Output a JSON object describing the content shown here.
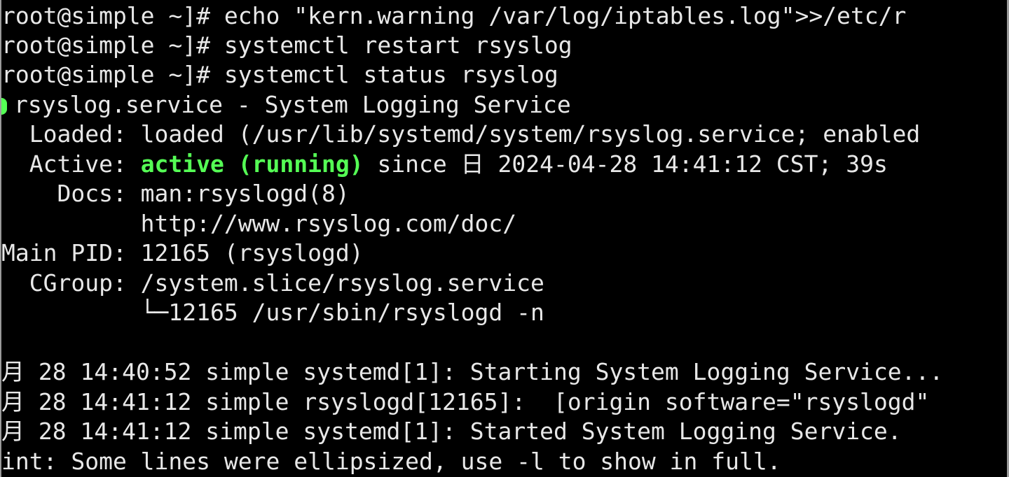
{
  "terminal": {
    "lines": {
      "l1": "root@simple ~]# echo \"kern.warning /var/log/iptables.log\">>/etc/r",
      "l2": "root@simple ~]# systemctl restart rsyslog",
      "l3": "root@simple ~]# systemctl status rsyslog",
      "l4": "rsyslog.service - System Logging Service",
      "l5": "  Loaded: loaded (/usr/lib/systemd/system/rsyslog.service; enabled",
      "l6_label": "  Active: ",
      "l6_status": "active (running)",
      "l6_rest": " since 日 2024-04-28 14:41:12 CST; 39s",
      "l7": "    Docs: man:rsyslogd(8)",
      "l8": "          http://www.rsyslog.com/doc/",
      "l9": "Main PID: 12165 (rsyslogd)",
      "l10": "  CGroup: /system.slice/rsyslog.service",
      "l11": "          └─12165 /usr/sbin/rsyslogd -n",
      "l12": "",
      "l13": "月 28 14:40:52 simple systemd[1]: Starting System Logging Service...",
      "l14": "月 28 14:41:12 simple rsyslogd[12165]:  [origin software=\"rsyslogd\"",
      "l15": "月 28 14:41:12 simple systemd[1]: Started System Logging Service.",
      "l16": "int: Some lines were ellipsized, use -l to show in full."
    },
    "colors": {
      "background": "#000000",
      "text": "#e8e8e8",
      "status_green": "#55ff55"
    },
    "icons": {
      "status_dot": "green-status-dot-icon"
    }
  }
}
